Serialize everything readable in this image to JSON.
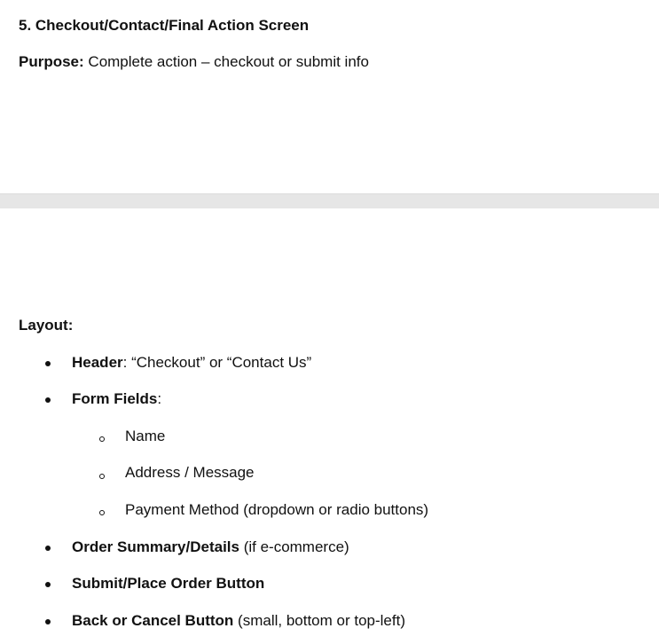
{
  "section_heading": "5. Checkout/Contact/Final Action Screen",
  "purpose": {
    "label": "Purpose:",
    "text": " Complete action – checkout or submit info"
  },
  "layout": {
    "label": "Layout:",
    "items": [
      {
        "bold": "Header",
        "text": ": “Checkout” or “Contact Us”"
      },
      {
        "bold": "Form Fields",
        "text": ":"
      },
      {
        "bold": "Order Summary/Details",
        "text": " (if e-commerce)"
      },
      {
        "bold": "Submit/Place Order Button",
        "text": ""
      },
      {
        "bold": "Back or Cancel Button",
        "text": " (small, bottom or top-left)"
      }
    ],
    "form_fields": [
      "Name",
      "Address / Message",
      "Payment Method (dropdown or radio buttons)"
    ]
  }
}
